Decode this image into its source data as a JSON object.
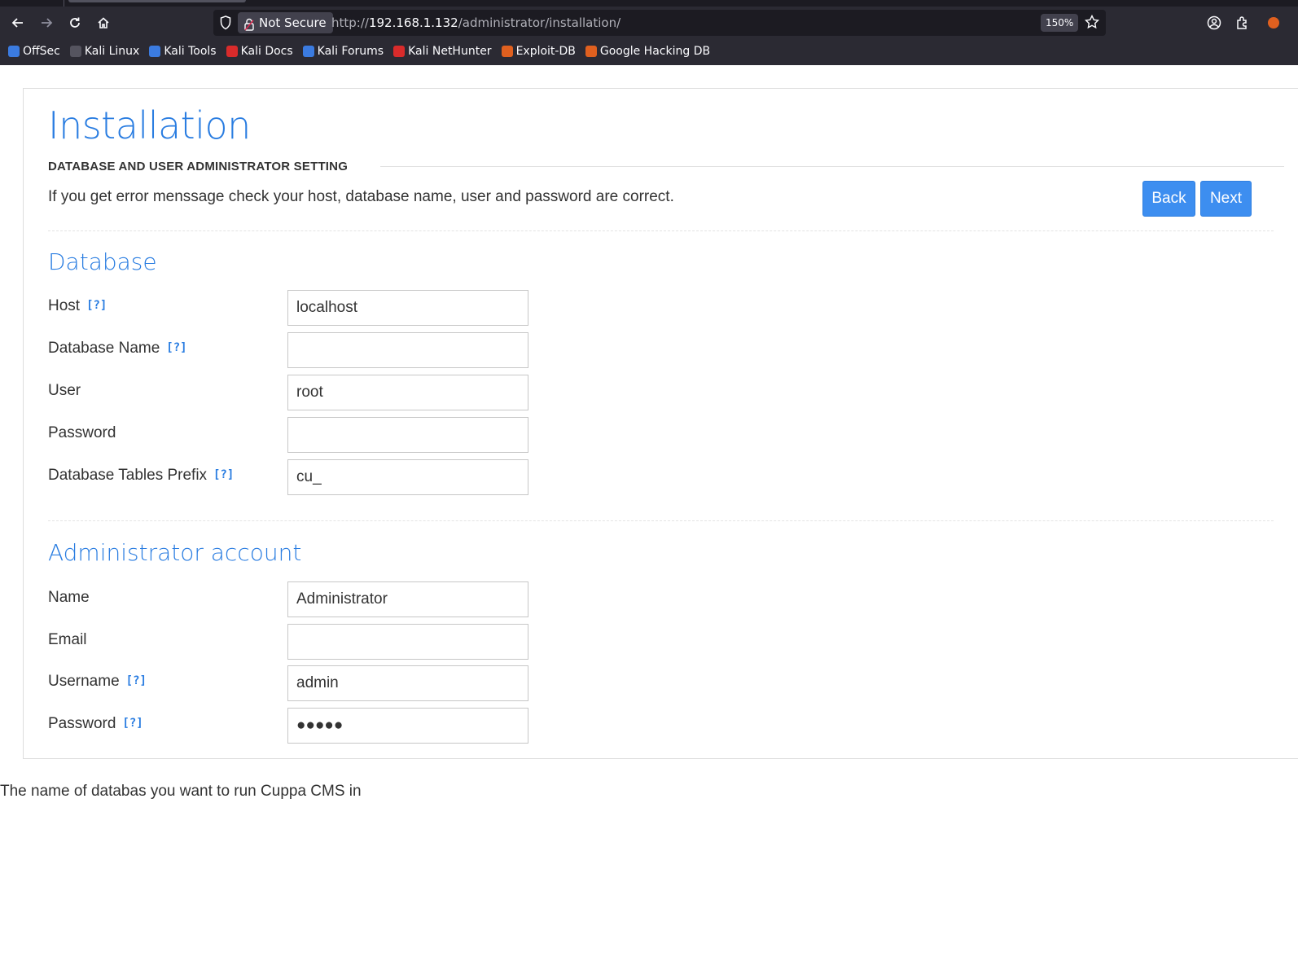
{
  "browser": {
    "security_label": "Not Secure",
    "url_scheme": "http://",
    "url_host": "192.168.1.132",
    "url_path": "/administrator/installation/",
    "zoom": "150%",
    "bookmarks": [
      {
        "label": "OffSec",
        "color": "#3b7be0"
      },
      {
        "label": "Kali Linux",
        "color": "#2b2a33"
      },
      {
        "label": "Kali Tools",
        "color": "#3b7be0"
      },
      {
        "label": "Kali Docs",
        "color": "#d92b2b"
      },
      {
        "label": "Kali Forums",
        "color": "#3b7be0"
      },
      {
        "label": "Kali NetHunter",
        "color": "#d92b2b"
      },
      {
        "label": "Exploit-DB",
        "color": "#e0601f"
      },
      {
        "label": "Google Hacking DB",
        "color": "#e0601f"
      }
    ]
  },
  "page": {
    "title": "Installation",
    "section_label": "DATABASE AND USER ADMINISTRATOR SETTING",
    "hint": "If you get error menssage check your host, database name, user and password are correct.",
    "back_label": "Back",
    "next_label": "Next",
    "help_marker": "[?]",
    "database": {
      "title": "Database",
      "fields": [
        {
          "label": "Host",
          "value": "localhost",
          "help": true
        },
        {
          "label": "Database Name",
          "value": "",
          "help": true
        },
        {
          "label": "User",
          "value": "root",
          "help": false
        },
        {
          "label": "Password",
          "value": "",
          "help": false
        },
        {
          "label": "Database Tables Prefix",
          "value": "cu_",
          "help": true
        }
      ]
    },
    "admin": {
      "title": "Administrator account",
      "fields": [
        {
          "label": "Name",
          "value": "Administrator",
          "help": false
        },
        {
          "label": "Email",
          "value": "",
          "help": false
        },
        {
          "label": "Username",
          "value": "admin",
          "help": true
        },
        {
          "label": "Password",
          "value": "●●●●●",
          "help": true
        }
      ]
    },
    "footer_tooltip": "The name of databas you want to run Cuppa CMS in"
  }
}
